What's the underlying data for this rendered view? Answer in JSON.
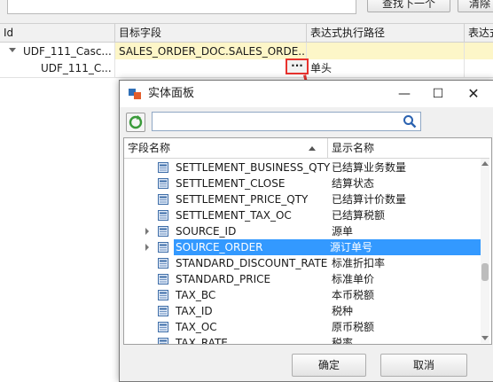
{
  "app": {
    "search_input": "",
    "find_next_label": "查找下一个",
    "clear_label": "清除",
    "grid": {
      "columns": [
        "Id",
        "目标字段",
        "表达式执行路径",
        "表达式"
      ],
      "rows": [
        {
          "id": "UDF_111_Casc...",
          "target": "SALES_ORDER_DOC.SALES_ORDE...",
          "path": ""
        },
        {
          "id": "UDF_111_C...",
          "target": "",
          "path": "单头"
        }
      ]
    },
    "ellipsis_label": "···",
    "colors": {
      "highlight_red": "#e8322e",
      "selection_blue": "#3399ff",
      "cell_yellow": "#fdf6c8"
    }
  },
  "dialog": {
    "title": "实体面板",
    "search_value": "",
    "columns": {
      "field_name": "字段名称",
      "display_name": "显示名称"
    },
    "rows": [
      {
        "field": "SETTLEMENT_BUSINESS_QTY",
        "display": "已结算业务数量",
        "expandable": false,
        "selected": false
      },
      {
        "field": "SETTLEMENT_CLOSE",
        "display": "结算状态",
        "expandable": false,
        "selected": false
      },
      {
        "field": "SETTLEMENT_PRICE_QTY",
        "display": "已结算计价数量",
        "expandable": false,
        "selected": false
      },
      {
        "field": "SETTLEMENT_TAX_OC",
        "display": "已结算税额",
        "expandable": false,
        "selected": false
      },
      {
        "field": "SOURCE_ID",
        "display": "源单",
        "expandable": true,
        "selected": false
      },
      {
        "field": "SOURCE_ORDER",
        "display": "源订单号",
        "expandable": true,
        "selected": true
      },
      {
        "field": "STANDARD_DISCOUNT_RATE",
        "display": "标准折扣率",
        "expandable": false,
        "selected": false
      },
      {
        "field": "STANDARD_PRICE",
        "display": "标准单价",
        "expandable": false,
        "selected": false
      },
      {
        "field": "TAX_BC",
        "display": "本币税额",
        "expandable": false,
        "selected": false
      },
      {
        "field": "TAX_ID",
        "display": "税种",
        "expandable": false,
        "selected": false
      },
      {
        "field": "TAX_OC",
        "display": "原币税额",
        "expandable": false,
        "selected": false
      },
      {
        "field": "TAX_RATE",
        "display": "税率",
        "expandable": false,
        "selected": false
      }
    ],
    "ok_label": "确定",
    "cancel_label": "取消",
    "icons": [
      "entity-panel-icon",
      "minimize-icon",
      "maximize-icon",
      "close-icon",
      "refresh-icon",
      "search-icon",
      "field-icon",
      "expand-triangle-icon",
      "sort-ascending-icon"
    ]
  }
}
